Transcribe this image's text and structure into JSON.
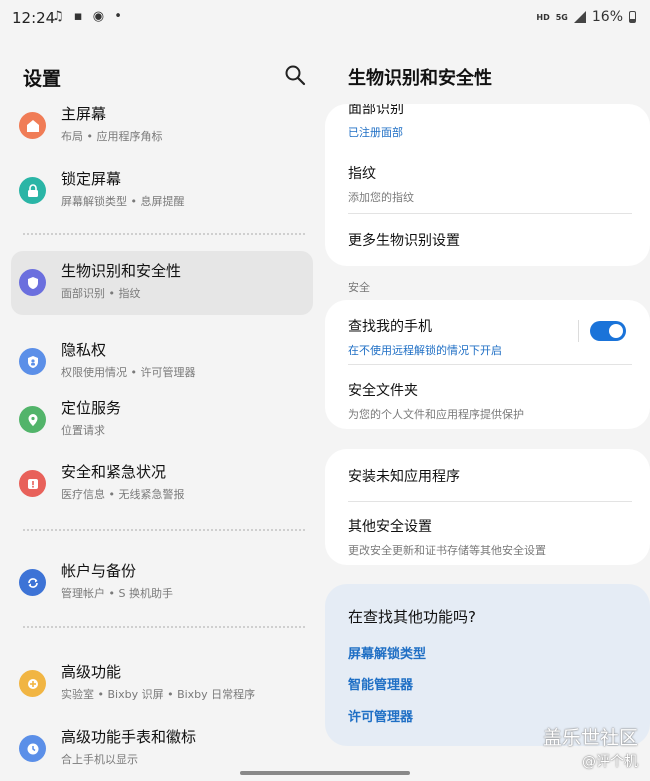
{
  "status_bar": {
    "time": "12:24",
    "left_icons": "♫ ▪ ◉ •",
    "signal_label_hd": "HD",
    "signal_label_5g": "5G",
    "battery": "16%"
  },
  "left_pane": {
    "title": "设置",
    "items": [
      {
        "title": "主屏幕",
        "subtitle": "布局 • 应用程序角标",
        "icon": "home-icon",
        "color": "#f07c56"
      },
      {
        "title": "锁定屏幕",
        "subtitle": "屏幕解锁类型 • 息屏提醒",
        "icon": "lock-icon",
        "color": "#2ab5a6"
      },
      {
        "title": "生物识别和安全性",
        "subtitle": "面部识别 • 指纹",
        "icon": "shield-icon",
        "color": "#6b6fde"
      },
      {
        "title": "隐私权",
        "subtitle": "权限使用情况 • 许可管理器",
        "icon": "privacy-icon",
        "color": "#5b8fe8"
      },
      {
        "title": "定位服务",
        "subtitle": "位置请求",
        "icon": "location-icon",
        "color": "#52b46a"
      },
      {
        "title": "安全和紧急状况",
        "subtitle": "医疗信息 • 无线紧急警报",
        "icon": "alert-icon",
        "color": "#e8615a"
      },
      {
        "title": "帐户与备份",
        "subtitle": "管理帐户 • S 换机助手",
        "icon": "sync-icon",
        "color": "#3d73d6"
      },
      {
        "title": "高级功能",
        "subtitle": "实验室 • Bixby 识屏 • Bixby 日常程序",
        "icon": "gear-plus-icon",
        "color": "#f1b543"
      },
      {
        "title": "高级功能手表和徽标",
        "subtitle": "合上手机以显示",
        "icon": "clock-icon",
        "color": "#5b8fe8"
      }
    ]
  },
  "right_pane": {
    "title": "生物识别和安全性",
    "face": {
      "title": "面部识别",
      "subtitle": "已注册面部"
    },
    "fingerprint": {
      "title": "指纹",
      "subtitle": "添加您的指纹"
    },
    "more_bio": {
      "title": "更多生物识别设置"
    },
    "security_label": "安全",
    "find_phone": {
      "title": "查找我的手机",
      "subtitle": "在不使用远程解锁的情况下开启",
      "toggle_on": true
    },
    "secure_folder": {
      "title": "安全文件夹",
      "subtitle": "为您的个人文件和应用程序提供保护"
    },
    "install_unknown": {
      "title": "安装未知应用程序"
    },
    "other_security": {
      "title": "其他安全设置",
      "subtitle": "更改安全更新和证书存储等其他安全设置"
    },
    "suggest": {
      "question": "在查找其他功能吗?",
      "links": [
        "屏幕解锁类型",
        "智能管理器",
        "许可管理器"
      ]
    }
  },
  "watermark": {
    "line1": "盖乐世社区",
    "line2": "@评个机"
  }
}
